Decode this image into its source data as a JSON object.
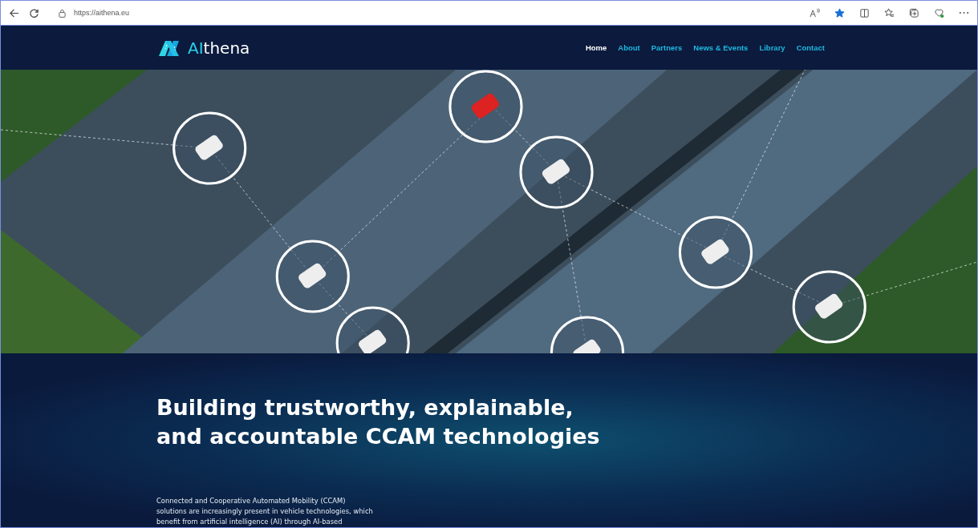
{
  "browser": {
    "url": "https://aithena.eu",
    "favorite": true
  },
  "site": {
    "logo": {
      "accent": "AI",
      "text": "thena"
    },
    "nav": [
      {
        "label": "Home",
        "selected": true
      },
      {
        "label": "About",
        "selected": false
      },
      {
        "label": "Partners",
        "selected": false
      },
      {
        "label": "News & Events",
        "selected": false
      },
      {
        "label": "Library",
        "selected": false
      },
      {
        "label": "Contact",
        "selected": false
      }
    ]
  },
  "hero": {
    "headline": [
      "Building trustworthy, explainable,",
      "and accountable CCAM technologies"
    ],
    "intro": [
      "Connected and Cooperative Automated Mobility (CCAM)",
      "solutions are increasingly present in vehicle technologies, which",
      "benefit from artificial intelligence (AI) through AI-based"
    ]
  }
}
